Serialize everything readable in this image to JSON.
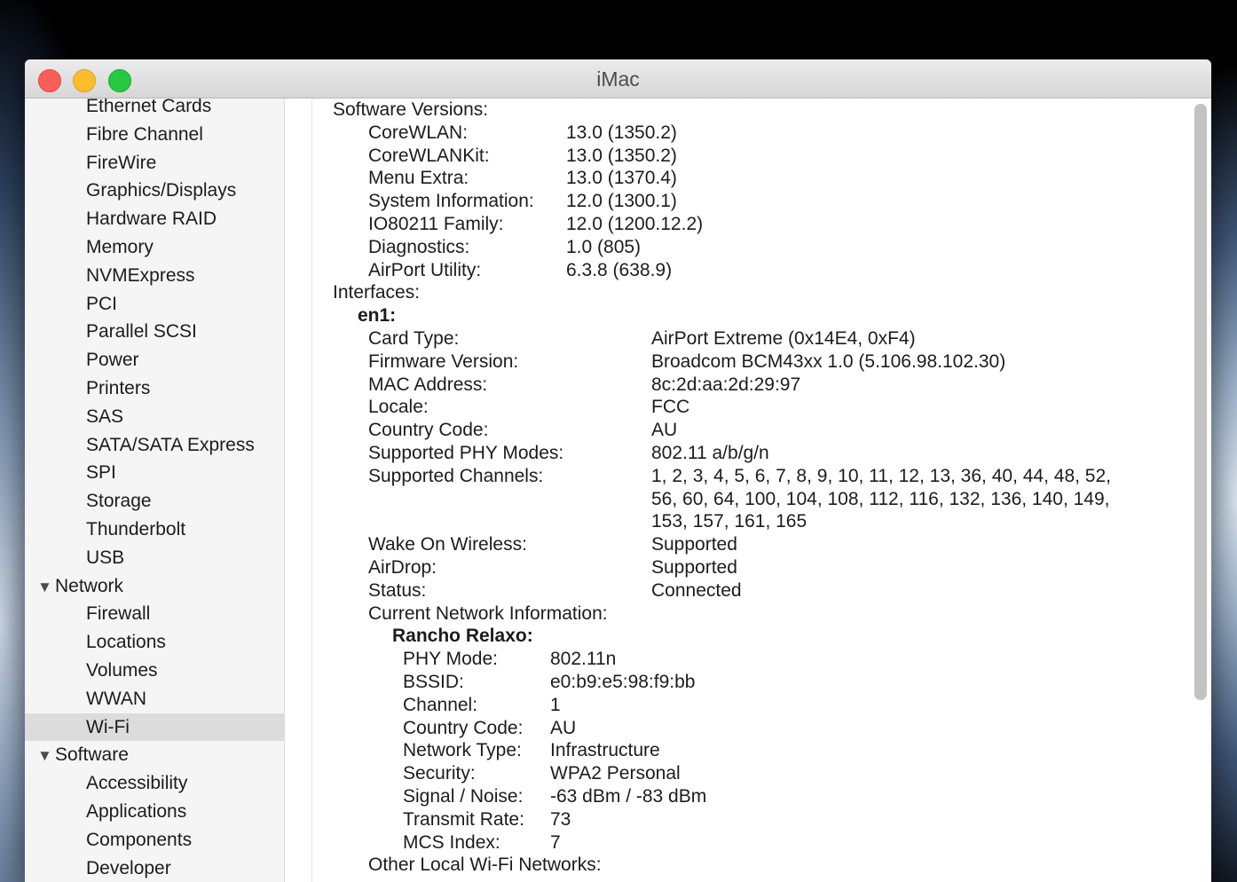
{
  "window": {
    "title": "iMac"
  },
  "sidebar": {
    "items": [
      {
        "label": "Ethernet Cards",
        "type": "item"
      },
      {
        "label": "Fibre Channel",
        "type": "item"
      },
      {
        "label": "FireWire",
        "type": "item"
      },
      {
        "label": "Graphics/Displays",
        "type": "item"
      },
      {
        "label": "Hardware RAID",
        "type": "item"
      },
      {
        "label": "Memory",
        "type": "item"
      },
      {
        "label": "NVMExpress",
        "type": "item"
      },
      {
        "label": "PCI",
        "type": "item"
      },
      {
        "label": "Parallel SCSI",
        "type": "item"
      },
      {
        "label": "Power",
        "type": "item"
      },
      {
        "label": "Printers",
        "type": "item"
      },
      {
        "label": "SAS",
        "type": "item"
      },
      {
        "label": "SATA/SATA Express",
        "type": "item"
      },
      {
        "label": "SPI",
        "type": "item"
      },
      {
        "label": "Storage",
        "type": "item"
      },
      {
        "label": "Thunderbolt",
        "type": "item"
      },
      {
        "label": "USB",
        "type": "item"
      },
      {
        "label": "Network",
        "type": "group"
      },
      {
        "label": "Firewall",
        "type": "item"
      },
      {
        "label": "Locations",
        "type": "item"
      },
      {
        "label": "Volumes",
        "type": "item"
      },
      {
        "label": "WWAN",
        "type": "item"
      },
      {
        "label": "Wi-Fi",
        "type": "item",
        "selected": true
      },
      {
        "label": "Software",
        "type": "group"
      },
      {
        "label": "Accessibility",
        "type": "item"
      },
      {
        "label": "Applications",
        "type": "item"
      },
      {
        "label": "Components",
        "type": "item"
      },
      {
        "label": "Developer",
        "type": "item"
      }
    ],
    "group_icon": "disclosure-triangle-down-icon"
  },
  "detail": {
    "software_versions_header": "Software Versions:",
    "software_versions": [
      {
        "k": "CoreWLAN:",
        "v": "13.0 (1350.2)"
      },
      {
        "k": "CoreWLANKit:",
        "v": "13.0 (1350.2)"
      },
      {
        "k": "Menu Extra:",
        "v": "13.0 (1370.4)"
      },
      {
        "k": "System Information:",
        "v": "12.0 (1300.1)"
      },
      {
        "k": "IO80211 Family:",
        "v": "12.0 (1200.12.2)"
      },
      {
        "k": "Diagnostics:",
        "v": "1.0 (805)"
      },
      {
        "k": "AirPort Utility:",
        "v": "6.3.8 (638.9)"
      }
    ],
    "interfaces_header": "Interfaces:",
    "interface_name": "en1:",
    "interface_props": [
      {
        "k": "Card Type:",
        "v": "AirPort Extreme  (0x14E4, 0xF4)"
      },
      {
        "k": "Firmware Version:",
        "v": "Broadcom BCM43xx 1.0 (5.106.98.102.30)"
      },
      {
        "k": "MAC Address:",
        "v": "8c:2d:aa:2d:29:97"
      },
      {
        "k": "Locale:",
        "v": "FCC"
      },
      {
        "k": "Country Code:",
        "v": "AU"
      },
      {
        "k": "Supported PHY Modes:",
        "v": "802.11 a/b/g/n"
      },
      {
        "k": "Supported Channels:",
        "v": "1, 2, 3, 4, 5, 6, 7, 8, 9, 10, 11, 12, 13, 36, 40, 44, 48, 52,"
      },
      {
        "k": "",
        "v": "56, 60, 64, 100, 104, 108, 112, 116, 132, 136, 140, 149,"
      },
      {
        "k": "",
        "v": "153, 157, 161, 165"
      },
      {
        "k": "Wake On Wireless:",
        "v": "Supported"
      },
      {
        "k": "AirDrop:",
        "v": "Supported"
      },
      {
        "k": "Status:",
        "v": "Connected"
      }
    ],
    "current_network_header": "Current Network Information:",
    "network_name": "Rancho Relaxo:",
    "network_props": [
      {
        "k": "PHY Mode:",
        "v": "802.11n"
      },
      {
        "k": "BSSID:",
        "v": "e0:b9:e5:98:f9:bb"
      },
      {
        "k": "Channel:",
        "v": "1"
      },
      {
        "k": "Country Code:",
        "v": "AU"
      },
      {
        "k": "Network Type:",
        "v": "Infrastructure"
      },
      {
        "k": "Security:",
        "v": "WPA2 Personal"
      },
      {
        "k": "Signal / Noise:",
        "v": "-63 dBm / -83 dBm"
      },
      {
        "k": "Transmit Rate:",
        "v": "73"
      },
      {
        "k": "MCS Index:",
        "v": "7"
      }
    ],
    "other_networks_header": "Other Local Wi-Fi Networks:"
  }
}
